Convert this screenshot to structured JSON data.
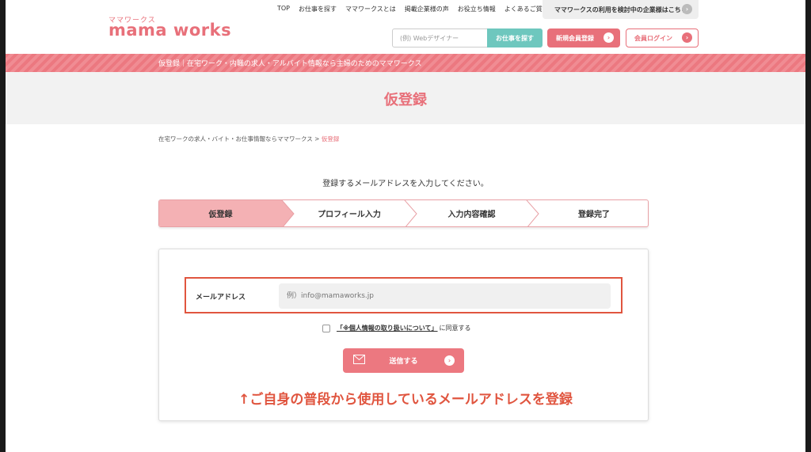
{
  "brand": {
    "logo_kana": "ママワークス",
    "logo_text": "mama works"
  },
  "nav": [
    "TOP",
    "お仕事を探す",
    "ママワークスとは",
    "掲載企業様の声",
    "お役立ち情報",
    "よくあるご質問"
  ],
  "header": {
    "corporate_link": "ママワークスの利用を検討中の企業様はこちら",
    "search_placeholder": "(例) Webデザイナー",
    "search_button": "お仕事を探す",
    "register_button": "新規会員登録",
    "login_button": "会員ログイン"
  },
  "stripe_text": "仮登録｜在宅ワーク・内職の求人・アルバイト情報なら主婦のためのママワークス",
  "page_title": "仮登録",
  "breadcrumb": {
    "home": "在宅ワークの求人・バイト・お仕事情報ならママワークス",
    "separator": ">",
    "current": "仮登録"
  },
  "instruction": "登録するメールアドレスを入力してください。",
  "steps": [
    {
      "label": "仮登録",
      "active": true
    },
    {
      "label": "プロフィール入力",
      "active": false
    },
    {
      "label": "入力内容確認",
      "active": false
    },
    {
      "label": "登録完了",
      "active": false
    }
  ],
  "form": {
    "email_label": "メールアドレス",
    "email_placeholder": "例）info@mamaworks.jp",
    "agree_link": "「※個人情報の取り扱いについて」",
    "agree_suffix": "に同意する",
    "submit_button": "送信する"
  },
  "annotation": "↑ご自身の普段から使用しているメールアドレスを登録",
  "colors": {
    "brand_pink": "#e8707a",
    "teal": "#6ec7be",
    "annotation_red": "#e0553f"
  }
}
